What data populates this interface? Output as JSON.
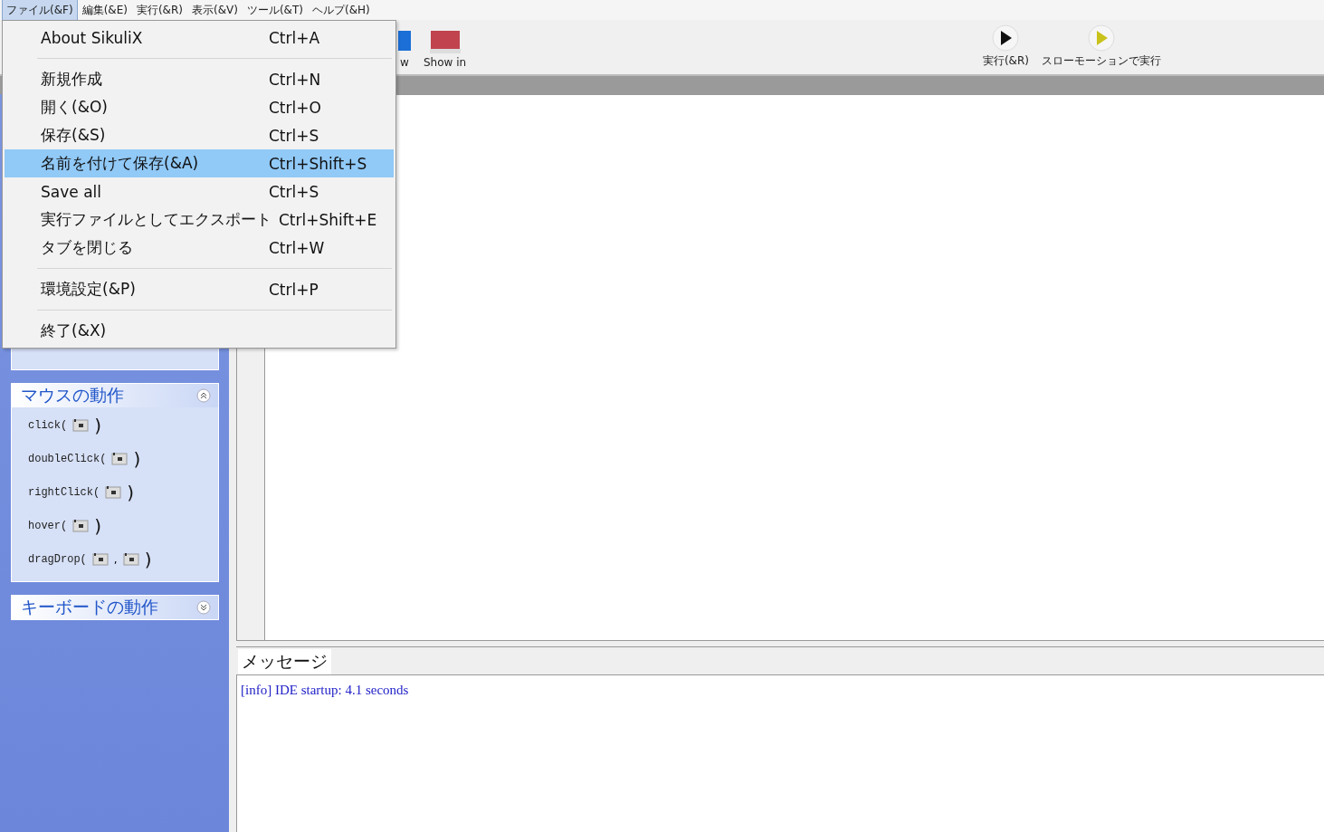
{
  "menubar": [
    {
      "label": "ファイル(&F)",
      "selected": true
    },
    {
      "label": "編集(&E)",
      "selected": false
    },
    {
      "label": "実行(&R)",
      "selected": false
    },
    {
      "label": "表示(&V)",
      "selected": false
    },
    {
      "label": "ツール(&T)",
      "selected": false
    },
    {
      "label": "ヘルプ(&H)",
      "selected": false
    }
  ],
  "file_menu": [
    {
      "kind": "item",
      "label": "About SikuliX",
      "shortcut": "Ctrl+A",
      "selected": false
    },
    {
      "kind": "separator"
    },
    {
      "kind": "item",
      "label": "新規作成",
      "shortcut": "Ctrl+N",
      "selected": false
    },
    {
      "kind": "item",
      "label": "開く(&O)",
      "shortcut": "Ctrl+O",
      "selected": false
    },
    {
      "kind": "item",
      "label": "保存(&S)",
      "shortcut": "Ctrl+S",
      "selected": false
    },
    {
      "kind": "item",
      "label": "名前を付けて保存(&A)",
      "shortcut": "Ctrl+Shift+S",
      "selected": true
    },
    {
      "kind": "item",
      "label": "Save all",
      "shortcut": "Ctrl+S",
      "selected": false
    },
    {
      "kind": "item",
      "label": "実行ファイルとしてエクスポート",
      "shortcut": "Ctrl+Shift+E",
      "selected": false
    },
    {
      "kind": "item",
      "label": "タブを閉じる",
      "shortcut": "Ctrl+W",
      "selected": false
    },
    {
      "kind": "separator"
    },
    {
      "kind": "item",
      "label": "環境設定(&P)",
      "shortcut": "Ctrl+P",
      "selected": false
    },
    {
      "kind": "separator"
    },
    {
      "kind": "item",
      "label": "終了(&X)",
      "selected": false
    }
  ],
  "toolbar": {
    "left": [
      {
        "kind": "screen",
        "label": "w"
      },
      {
        "kind": "show",
        "label": "Show in"
      }
    ],
    "right": [
      {
        "kind": "run",
        "label": "実行(&R)"
      },
      {
        "kind": "slow",
        "label": "スローモーションで実行"
      }
    ]
  },
  "sidebar": {
    "sections": [
      {
        "title": "マウスの動作",
        "expanded": true,
        "commands": [
          {
            "name": "click(",
            "kind": "single"
          },
          {
            "name": "doubleClick(",
            "kind": "single"
          },
          {
            "name": "rightClick(",
            "kind": "single"
          },
          {
            "name": "hover(",
            "kind": "single"
          },
          {
            "name": "dragDrop(",
            "kind": "pair",
            "separator": ","
          }
        ]
      },
      {
        "title": "キーボードの動作",
        "expanded": false
      }
    ],
    "closing": ")"
  },
  "messages": {
    "tab": "メッセージ",
    "lines": [
      "[info] IDE startup: 4.1 seconds"
    ]
  }
}
